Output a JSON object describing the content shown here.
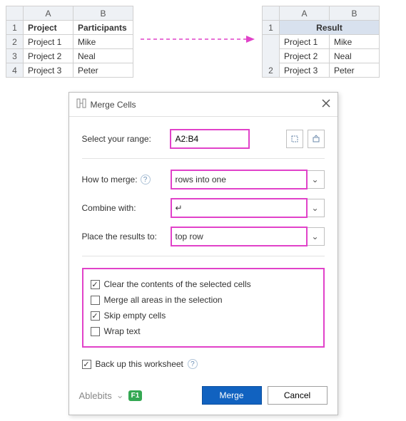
{
  "left_sheet": {
    "col_headers": [
      "A",
      "B"
    ],
    "rows": [
      {
        "n": "1",
        "a": "Project",
        "b": "Participants",
        "bold": true
      },
      {
        "n": "2",
        "a": "Project 1",
        "b": "Mike"
      },
      {
        "n": "3",
        "a": "Project 2",
        "b": "Neal"
      },
      {
        "n": "4",
        "a": "Project 3",
        "b": "Peter"
      }
    ]
  },
  "right_sheet": {
    "col_headers": [
      "A",
      "B"
    ],
    "result_label": "Result",
    "rows": [
      {
        "n": "1"
      },
      {
        "n": "",
        "a": "Project 1",
        "b": "Mike"
      },
      {
        "n": "",
        "a": "Project 2",
        "b": "Neal"
      },
      {
        "n": "2",
        "a": "Project 3",
        "b": "Peter"
      }
    ]
  },
  "dialog": {
    "title": "Merge Cells",
    "labels": {
      "range": "Select your range:",
      "how": "How to merge:",
      "combine": "Combine with:",
      "place": "Place the results to:"
    },
    "values": {
      "range": "A2:B4",
      "how": "rows into one",
      "combine": "↵",
      "place": "top row"
    },
    "checks": {
      "clear": "Clear the contents of the selected cells",
      "merge_all": "Merge all areas in the selection",
      "skip": "Skip empty cells",
      "wrap": "Wrap text",
      "backup": "Back up this worksheet"
    },
    "check_state": {
      "clear": true,
      "merge_all": false,
      "skip": true,
      "wrap": false,
      "backup": true
    },
    "brand": "Ablebits",
    "f1": "F1",
    "buttons": {
      "merge": "Merge",
      "cancel": "Cancel"
    }
  }
}
